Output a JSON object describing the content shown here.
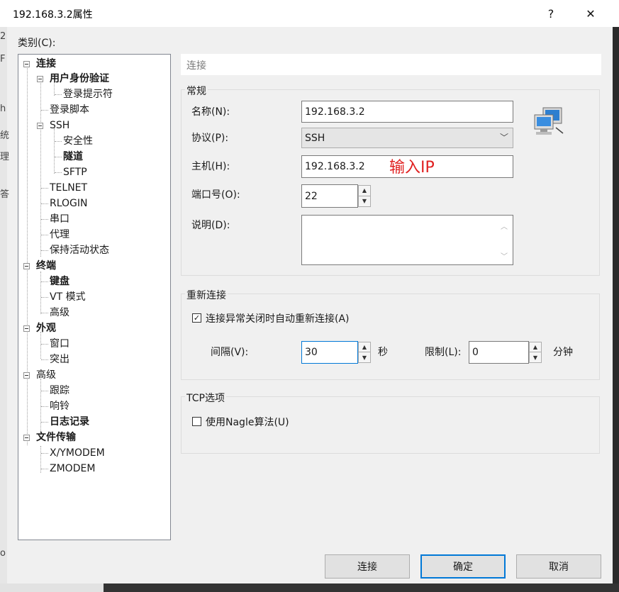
{
  "window": {
    "title": "192.168.3.2属性",
    "help_label": "?",
    "close_label": "✕"
  },
  "background_fragments": [
    "2",
    "F",
    "h",
    "统",
    "理",
    "答",
    "o"
  ],
  "category_label": "类别(C):",
  "tree": [
    {
      "label": "连接",
      "bold": true
    },
    {
      "label": "用户身份验证",
      "bold": true
    },
    {
      "label": "登录提示符",
      "bold": false
    },
    {
      "label": "登录脚本",
      "bold": false
    },
    {
      "label": "SSH",
      "bold": false
    },
    {
      "label": "安全性",
      "bold": false
    },
    {
      "label": "隧道",
      "bold": true
    },
    {
      "label": "SFTP",
      "bold": false
    },
    {
      "label": "TELNET",
      "bold": false
    },
    {
      "label": "RLOGIN",
      "bold": false
    },
    {
      "label": "串口",
      "bold": false
    },
    {
      "label": "代理",
      "bold": false
    },
    {
      "label": "保持活动状态",
      "bold": false
    },
    {
      "label": "终端",
      "bold": true
    },
    {
      "label": "键盘",
      "bold": true
    },
    {
      "label": "VT 模式",
      "bold": false
    },
    {
      "label": "高级",
      "bold": false
    },
    {
      "label": "外观",
      "bold": true
    },
    {
      "label": "窗口",
      "bold": false
    },
    {
      "label": "突出",
      "bold": false
    },
    {
      "label": "高级",
      "bold": false
    },
    {
      "label": "跟踪",
      "bold": false
    },
    {
      "label": "响铃",
      "bold": false
    },
    {
      "label": "日志记录",
      "bold": true
    },
    {
      "label": "文件传输",
      "bold": true
    },
    {
      "label": "X/YMODEM",
      "bold": false
    },
    {
      "label": "ZMODEM",
      "bold": false
    }
  ],
  "section_title": "连接",
  "general": {
    "group_title": "常规",
    "name_label": "名称(N):",
    "name_value": "192.168.3.2",
    "protocol_label": "协议(P):",
    "protocol_value": "SSH",
    "host_label": "主机(H):",
    "host_value": "192.168.3.2",
    "annotation": "输入IP",
    "port_label": "端口号(O):",
    "port_value": "22",
    "desc_label": "说明(D):",
    "desc_value": ""
  },
  "reconnect": {
    "group_title": "重新连接",
    "auto_label": "连接异常关闭时自动重新连接(A)",
    "auto_checked": "✓",
    "interval_label": "间隔(V):",
    "interval_value": "30",
    "interval_unit": "秒",
    "limit_label": "限制(L):",
    "limit_value": "0",
    "limit_unit": "分钟"
  },
  "tcp": {
    "group_title": "TCP选项",
    "nagle_label": "使用Nagle算法(U)",
    "nagle_checked": ""
  },
  "buttons": {
    "connect": "连接",
    "ok": "确定",
    "cancel": "取消"
  },
  "colors": {
    "accent": "#0078d7",
    "annotation": "#e02020"
  }
}
